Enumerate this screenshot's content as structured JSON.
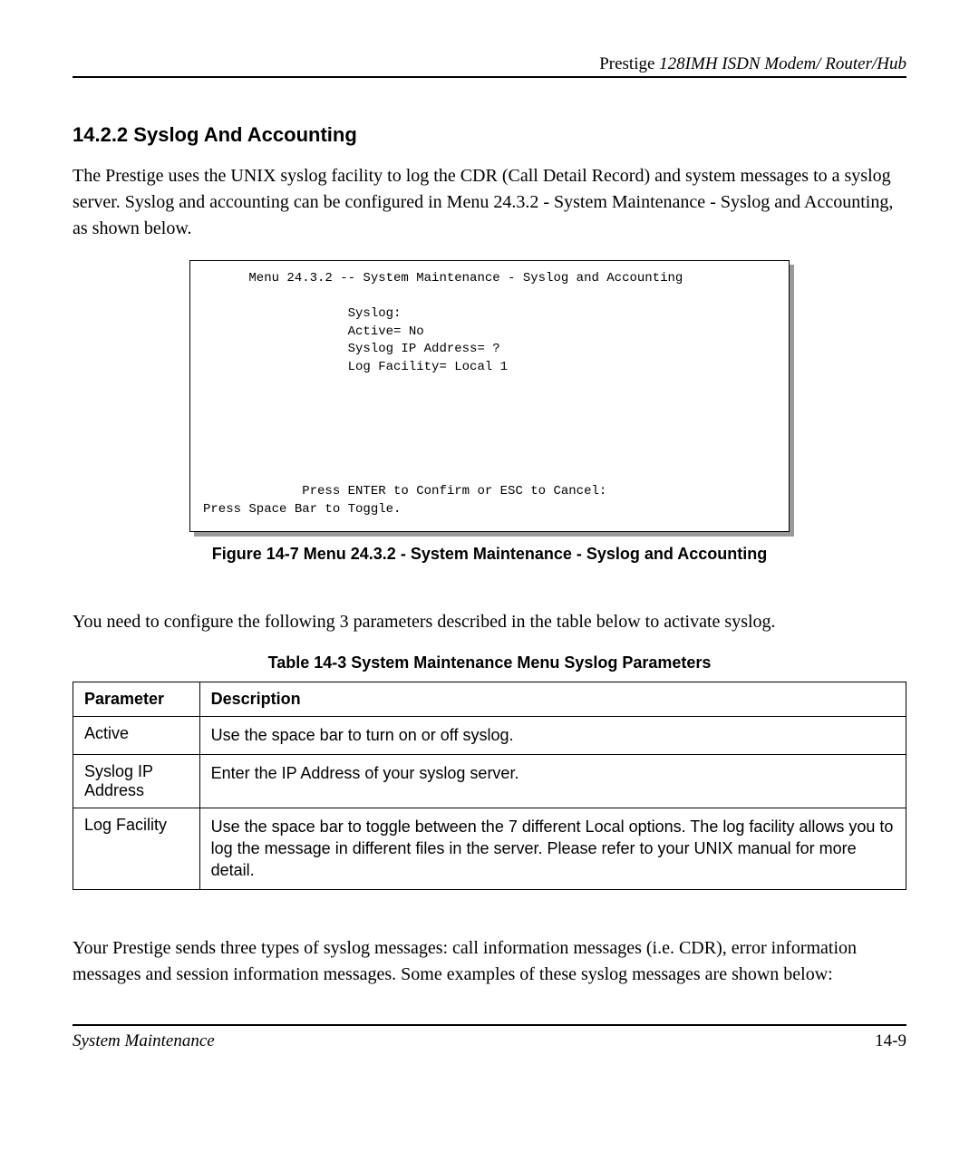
{
  "header": {
    "brand": "Prestige ",
    "model": "128IMH  ISDN Modem/ Router/Hub"
  },
  "section": {
    "number": "14.2.2",
    "title": "Syslog And Accounting"
  },
  "intro_paragraph": "The Prestige uses the UNIX syslog facility to log the CDR (Call Detail Record) and system messages to a syslog server. Syslog and accounting can be configured in Menu 24.3.2 - System Maintenance - Syslog and Accounting, as shown below.",
  "terminal_text": "      Menu 24.3.2 -- System Maintenance - Syslog and Accounting\n\n                   Syslog:\n                   Active= No\n                   Syslog IP Address= ?\n                   Log Facility= Local 1\n\n\n\n\n\n\n             Press ENTER to Confirm or ESC to Cancel:\nPress Space Bar to Toggle.",
  "figure_caption": "Figure 14-7 Menu 24.3.2 - System Maintenance - Syslog and Accounting",
  "mid_paragraph": "You need to configure the following 3 parameters described in the table below to activate syslog.",
  "table_caption": "Table 14-3 System Maintenance Menu Syslog Parameters",
  "table": {
    "headers": [
      "Parameter",
      "Description"
    ],
    "rows": [
      {
        "param": "Active",
        "desc": "Use the space bar to turn on or off syslog."
      },
      {
        "param": "Syslog IP Address",
        "desc": "Enter the IP Address of your syslog server."
      },
      {
        "param": "Log Facility",
        "desc": "Use the space bar to toggle between the 7 different Local options. The log facility allows you to log the message in different files in the server. Please refer to your UNIX manual for more detail."
      }
    ]
  },
  "closing_paragraph": "Your Prestige sends three types of syslog messages: call information messages (i.e. CDR), error information messages and session information messages. Some examples of these syslog messages are shown below:",
  "footer": {
    "left": "System Maintenance",
    "right": "14-9"
  }
}
